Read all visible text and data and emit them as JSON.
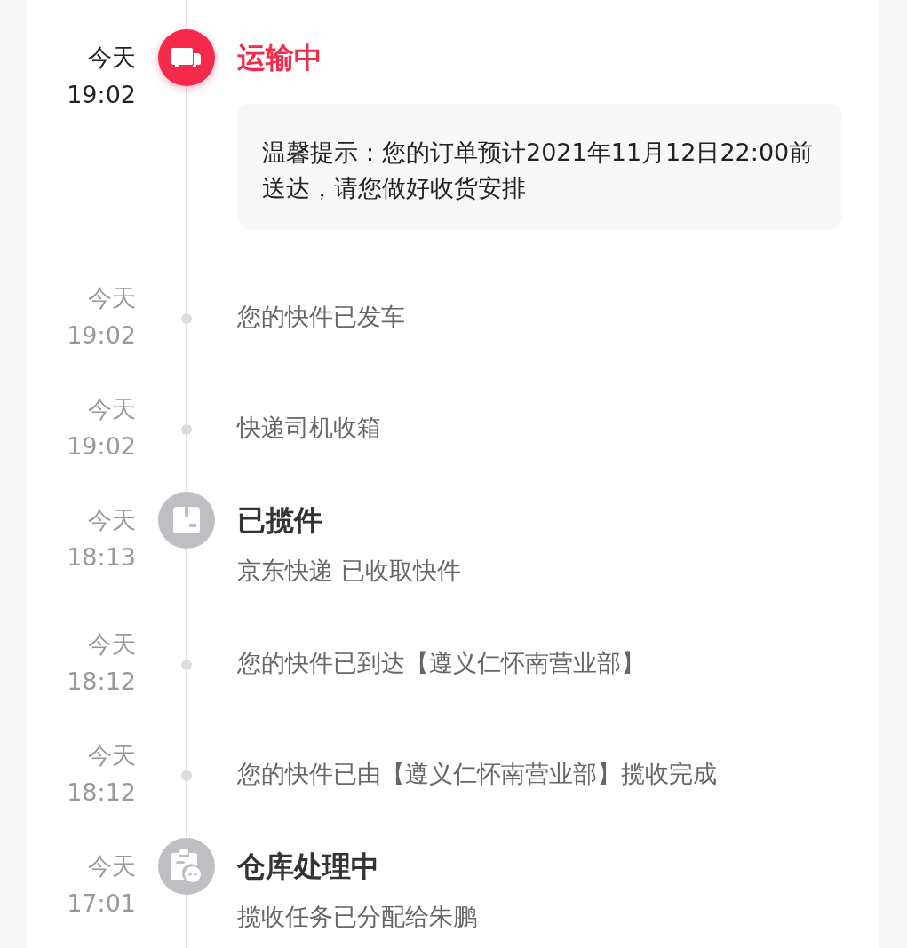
{
  "entries": [
    {
      "kind": "status",
      "active": true,
      "date": "今天",
      "time": "19:02",
      "title": "运输中",
      "note": "温馨提示：您的订单预计2021年11月12日22:00前送达，请您做好收货安排"
    },
    {
      "kind": "event",
      "active": false,
      "date": "今天",
      "time": "19:02",
      "text": "您的快件已发车"
    },
    {
      "kind": "event",
      "active": false,
      "date": "今天",
      "time": "19:02",
      "text": "快递司机收箱"
    },
    {
      "kind": "status",
      "active": false,
      "date": "今天",
      "time": "18:13",
      "title": "已揽件",
      "desc": "京东快递 已收取快件"
    },
    {
      "kind": "event",
      "active": false,
      "date": "今天",
      "time": "18:12",
      "text": "您的快件已到达【遵义仁怀南营业部】"
    },
    {
      "kind": "event",
      "active": false,
      "date": "今天",
      "time": "18:12",
      "text": "您的快件已由【遵义仁怀南营业部】揽收完成"
    },
    {
      "kind": "status",
      "active": false,
      "date": "今天",
      "time": "17:01",
      "title": "仓库处理中",
      "desc": "揽收任务已分配给朱鹏"
    }
  ]
}
